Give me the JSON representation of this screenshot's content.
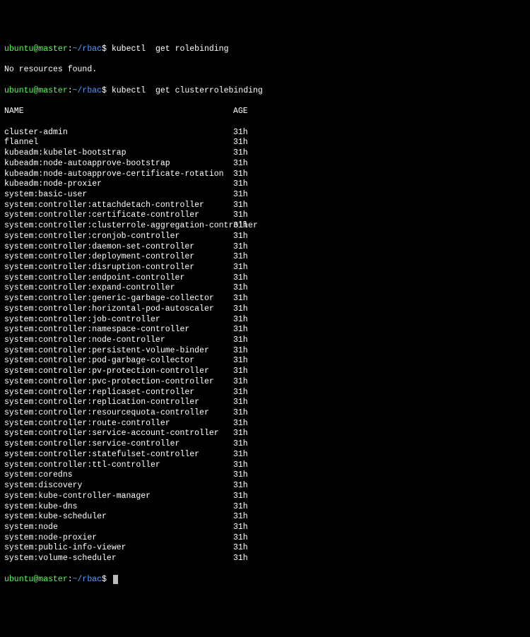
{
  "prompt": {
    "user_host": "ubuntu@master",
    "sep": ":",
    "path": "~/rbac",
    "dollar": "$"
  },
  "commands": {
    "cmd1": "kubectl  get rolebinding",
    "cmd1_output": "No resources found.",
    "cmd2": "kubectl  get clusterrolebinding"
  },
  "header": {
    "name": "NAME",
    "age": "AGE"
  },
  "rows": [
    {
      "name": "cluster-admin",
      "age": "31h"
    },
    {
      "name": "flannel",
      "age": "31h"
    },
    {
      "name": "kubeadm:kubelet-bootstrap",
      "age": "31h"
    },
    {
      "name": "kubeadm:node-autoapprove-bootstrap",
      "age": "31h"
    },
    {
      "name": "kubeadm:node-autoapprove-certificate-rotation",
      "age": "31h"
    },
    {
      "name": "kubeadm:node-proxier",
      "age": "31h"
    },
    {
      "name": "system:basic-user",
      "age": "31h"
    },
    {
      "name": "system:controller:attachdetach-controller",
      "age": "31h"
    },
    {
      "name": "system:controller:certificate-controller",
      "age": "31h"
    },
    {
      "name": "system:controller:clusterrole-aggregation-controller",
      "age": "31h"
    },
    {
      "name": "system:controller:cronjob-controller",
      "age": "31h"
    },
    {
      "name": "system:controller:daemon-set-controller",
      "age": "31h"
    },
    {
      "name": "system:controller:deployment-controller",
      "age": "31h"
    },
    {
      "name": "system:controller:disruption-controller",
      "age": "31h"
    },
    {
      "name": "system:controller:endpoint-controller",
      "age": "31h"
    },
    {
      "name": "system:controller:expand-controller",
      "age": "31h"
    },
    {
      "name": "system:controller:generic-garbage-collector",
      "age": "31h"
    },
    {
      "name": "system:controller:horizontal-pod-autoscaler",
      "age": "31h"
    },
    {
      "name": "system:controller:job-controller",
      "age": "31h"
    },
    {
      "name": "system:controller:namespace-controller",
      "age": "31h"
    },
    {
      "name": "system:controller:node-controller",
      "age": "31h"
    },
    {
      "name": "system:controller:persistent-volume-binder",
      "age": "31h"
    },
    {
      "name": "system:controller:pod-garbage-collector",
      "age": "31h"
    },
    {
      "name": "system:controller:pv-protection-controller",
      "age": "31h"
    },
    {
      "name": "system:controller:pvc-protection-controller",
      "age": "31h"
    },
    {
      "name": "system:controller:replicaset-controller",
      "age": "31h"
    },
    {
      "name": "system:controller:replication-controller",
      "age": "31h"
    },
    {
      "name": "system:controller:resourcequota-controller",
      "age": "31h"
    },
    {
      "name": "system:controller:route-controller",
      "age": "31h"
    },
    {
      "name": "system:controller:service-account-controller",
      "age": "31h"
    },
    {
      "name": "system:controller:service-controller",
      "age": "31h"
    },
    {
      "name": "system:controller:statefulset-controller",
      "age": "31h"
    },
    {
      "name": "system:controller:ttl-controller",
      "age": "31h"
    },
    {
      "name": "system:coredns",
      "age": "31h"
    },
    {
      "name": "system:discovery",
      "age": "31h"
    },
    {
      "name": "system:kube-controller-manager",
      "age": "31h"
    },
    {
      "name": "system:kube-dns",
      "age": "31h"
    },
    {
      "name": "system:kube-scheduler",
      "age": "31h"
    },
    {
      "name": "system:node",
      "age": "31h"
    },
    {
      "name": "system:node-proxier",
      "age": "31h"
    },
    {
      "name": "system:public-info-viewer",
      "age": "31h"
    },
    {
      "name": "system:volume-scheduler",
      "age": "31h"
    }
  ]
}
